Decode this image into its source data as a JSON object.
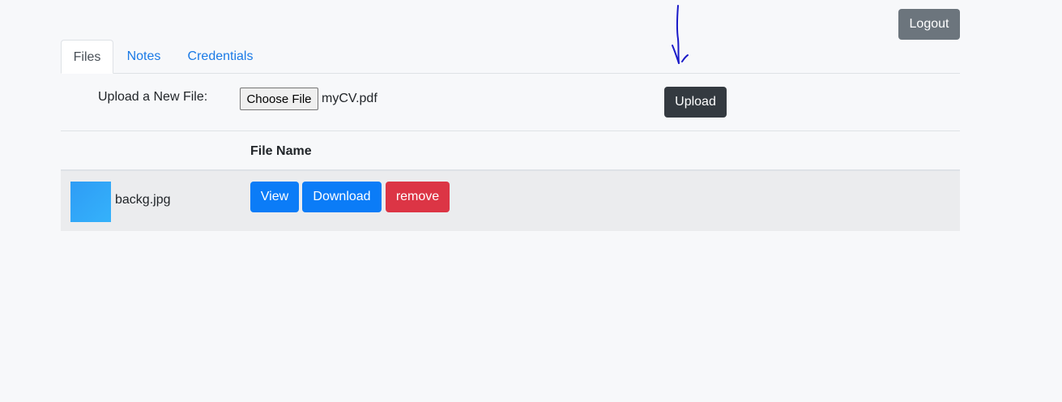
{
  "header": {
    "logout_label": "Logout"
  },
  "tabs": [
    {
      "label": "Files",
      "active": true
    },
    {
      "label": "Notes",
      "active": false
    },
    {
      "label": "Credentials",
      "active": false
    }
  ],
  "upload": {
    "label": "Upload a New File:",
    "choose_file_label": "Choose File",
    "chosen_file": "myCV.pdf",
    "upload_label": "Upload"
  },
  "table": {
    "columns": [
      "",
      "File Name"
    ],
    "rows": [
      {
        "file_name": "backg.jpg",
        "view_label": "View",
        "download_label": "Download",
        "remove_label": "remove"
      }
    ]
  },
  "colors": {
    "primary": "#0b7cf7",
    "danger": "#dc3545",
    "secondary": "#6c757d",
    "dark": "#343a40",
    "annotation": "#1a1ac8"
  },
  "icons": {
    "file_thumbnail": "image-thumbnail-icon",
    "annotation": "hand-drawn-arrow-icon"
  }
}
